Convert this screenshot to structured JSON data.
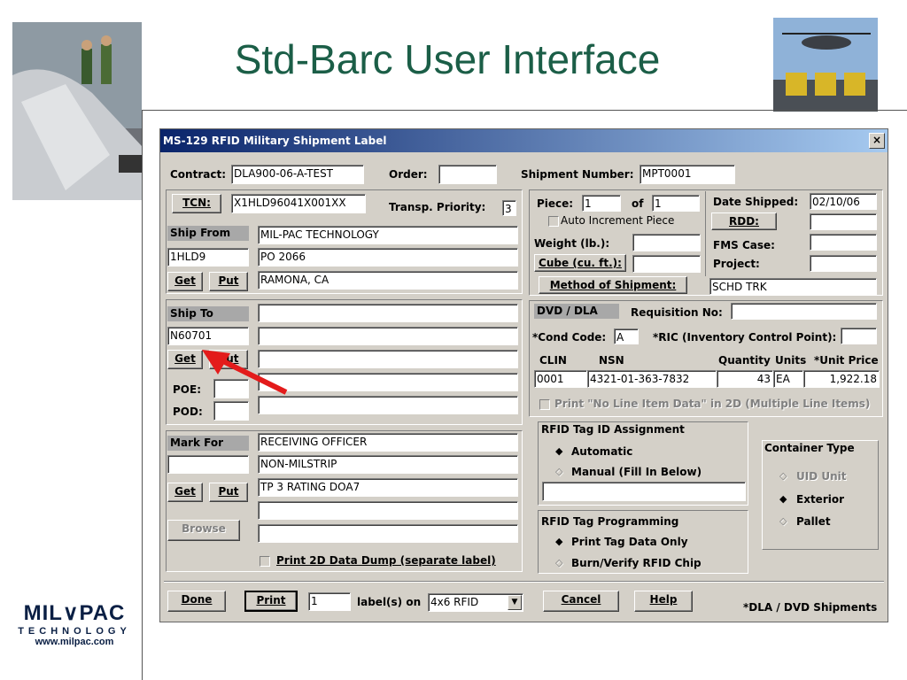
{
  "slide": {
    "title": "Std-Barc User Interface"
  },
  "logo": {
    "brand": "MIL∨PAC",
    "tech": "TECHNOLOGY",
    "url": "www.milpac.com"
  },
  "dialog": {
    "title": "MS-129 RFID Military Shipment Label",
    "close": "×",
    "contract_label": "Contract:",
    "contract_value": "DLA900-06-A-TEST",
    "order_label": "Order:",
    "order_value": "",
    "shipment_number_label": "Shipment Number:",
    "shipment_number_value": "MPT0001",
    "tcn_button": "TCN:",
    "tcn_value": "X1HLD96041X001XX",
    "transp_priority_label": "Transp. Priority:",
    "transp_priority_value": "3",
    "piece_label": "Piece:",
    "piece_value": "1",
    "of_label": "of",
    "of_value": "1",
    "auto_increment_label": "Auto Increment Piece",
    "date_shipped_label": "Date Shipped:",
    "date_shipped_value": "02/10/06",
    "rdd_button": "RDD:",
    "rdd_value": "",
    "weight_label": "Weight (lb.):",
    "weight_value": "",
    "fms_case_label": "FMS Case:",
    "fms_case_value": "",
    "cube_button": "Cube (cu. ft.):",
    "cube_value": "",
    "project_label": "Project:",
    "project_value": "",
    "method_button": "Method of Shipment:",
    "method_value": "SCHD TRK",
    "ship_from": {
      "header": "Ship From",
      "code": "1HLD9",
      "line1": "MIL-PAC TECHNOLOGY",
      "line2": "PO 2066",
      "line3": "RAMONA, CA",
      "get": "Get",
      "put": "Put"
    },
    "ship_to": {
      "header": "Ship To",
      "code": "N60701",
      "line1": "",
      "line2": "",
      "line3": "",
      "line4": "",
      "line5": "",
      "get": "Get",
      "put": "Put",
      "poe_label": "POE:",
      "poe_value": "",
      "pod_label": "POD:",
      "pod_value": ""
    },
    "mark_for": {
      "header": "Mark For",
      "code": "",
      "line1": "RECEIVING OFFICER",
      "line2": "NON-MILSTRIP",
      "line3": "TP 3 RATING DOA7",
      "line4": "",
      "line5": "",
      "get": "Get",
      "put": "Put"
    },
    "browse_button": "Browse",
    "print_2d_dump": "Print 2D Data Dump (separate label)",
    "dvd_dla_header": "DVD / DLA",
    "requisition_label": "Requisition No:",
    "requisition_value": "",
    "cond_code_label": "*Cond Code:",
    "cond_code_value": "A",
    "ric_label": "*RIC (Inventory Control Point):",
    "ric_value": "",
    "line_headers": {
      "clin": "CLIN",
      "nsn": "NSN",
      "quantity": "Quantity",
      "units": "Units",
      "unit_price": "*Unit Price"
    },
    "line_item": {
      "clin": "0001",
      "nsn": "4321-01-363-7832",
      "quantity": "43",
      "units": "EA",
      "unit_price": "1,922.18"
    },
    "print_no_line_item": "Print \"No Line Item Data\" in 2D (Multiple Line Items)",
    "rfid_assign": {
      "header": "RFID Tag ID Assignment",
      "automatic": "Automatic",
      "manual": "Manual (Fill In Below)",
      "manual_value": ""
    },
    "rfid_program": {
      "header": "RFID Tag Programming",
      "print_only": "Print Tag Data Only",
      "burn_verify": "Burn/Verify RFID Chip"
    },
    "container": {
      "header": "Container Type",
      "uid_unit": "UID Unit",
      "exterior": "Exterior",
      "pallet": "Pallet"
    },
    "done_button": "Done",
    "print_button": "Print",
    "label_count": "1",
    "labels_on_label": "label(s) on",
    "label_format": "4x6 RFID",
    "cancel_button": "Cancel",
    "help_button": "Help",
    "footnote": "*DLA / DVD Shipments"
  }
}
